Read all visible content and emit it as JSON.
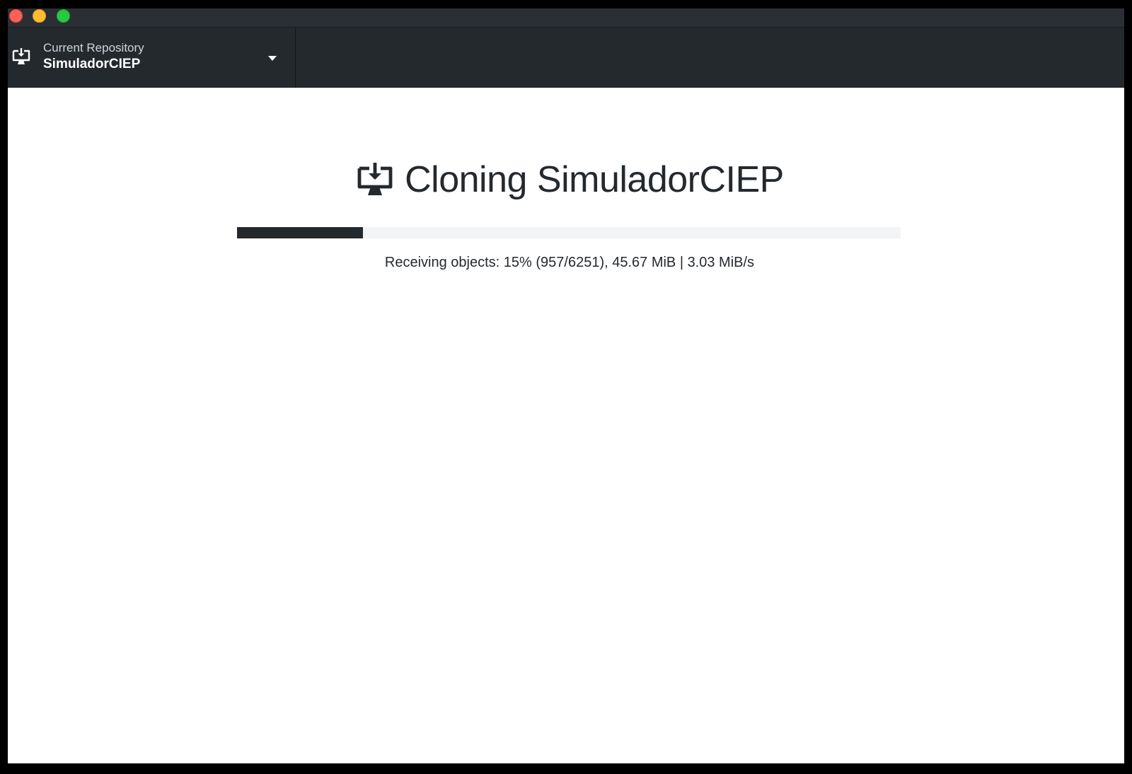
{
  "window": {
    "controls": [
      "close",
      "minimize",
      "maximize"
    ]
  },
  "toolbar": {
    "repository": {
      "label": "Current Repository",
      "name": "SimuladorCIEP",
      "icon": "desktop-download-icon",
      "dropdown_icon": "caret-down-icon"
    }
  },
  "clone": {
    "title": "Cloning SimuladorCIEP",
    "icon": "desktop-download-icon",
    "progress_fraction": 0.19,
    "status": "Receiving objects: 15% (957/6251), 45.67 MiB | 3.03 MiB/s"
  },
  "colors": {
    "toolbar_bg": "#24292e",
    "progress_fill": "#24292e",
    "progress_track": "#f3f4f5",
    "close": "#fe5f57",
    "minimize": "#febc2e",
    "maximize": "#28c840"
  }
}
